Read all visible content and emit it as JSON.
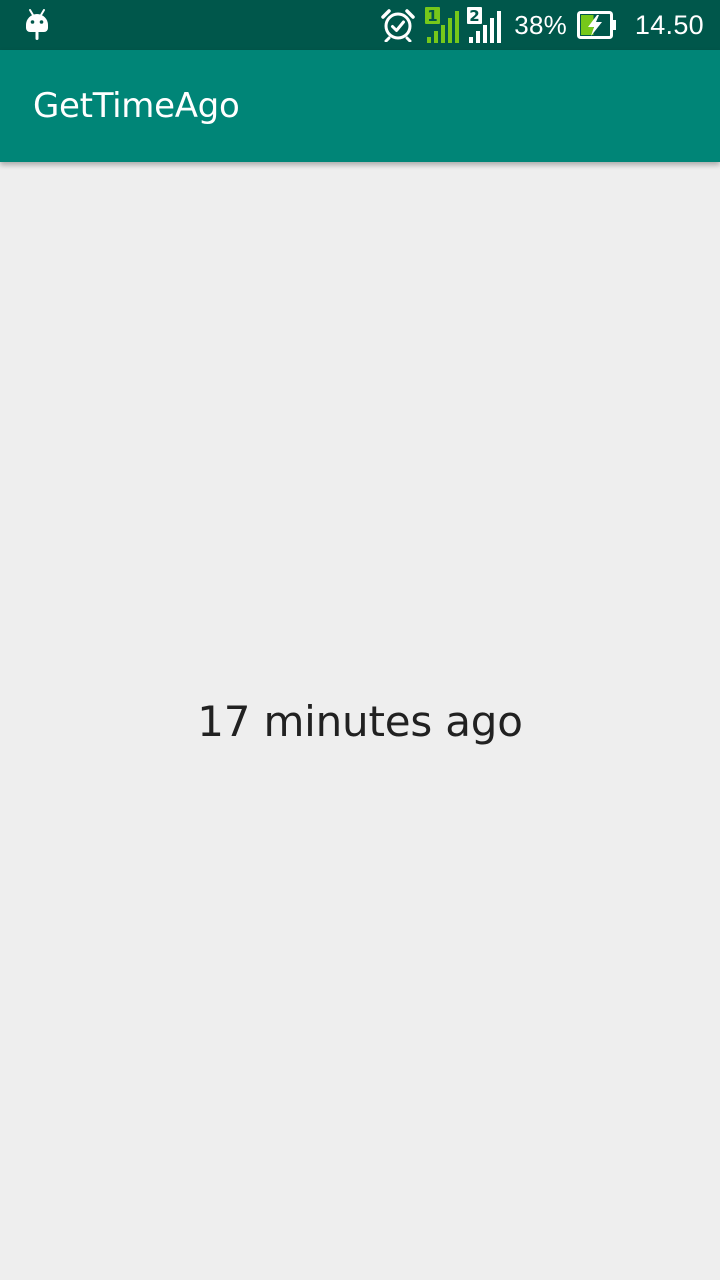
{
  "status_bar": {
    "notification_icon": "android-debug-icon",
    "icons": [
      "alarm-icon",
      "sim1-signal-icon",
      "sim2-signal-icon",
      "battery-charging-icon"
    ],
    "sim1_label": "1",
    "sim2_label": "2",
    "battery_percent": "38%",
    "time": "14.50"
  },
  "app_bar": {
    "title": "GetTimeAgo"
  },
  "main": {
    "time_ago_text": "17 minutes ago"
  },
  "colors": {
    "status_bar": "#00574b",
    "app_bar": "#008577",
    "background": "#eeeeee",
    "text": "#212121",
    "signal_active_sim1": "#76c81a",
    "battery_fill": "#76c81a"
  }
}
